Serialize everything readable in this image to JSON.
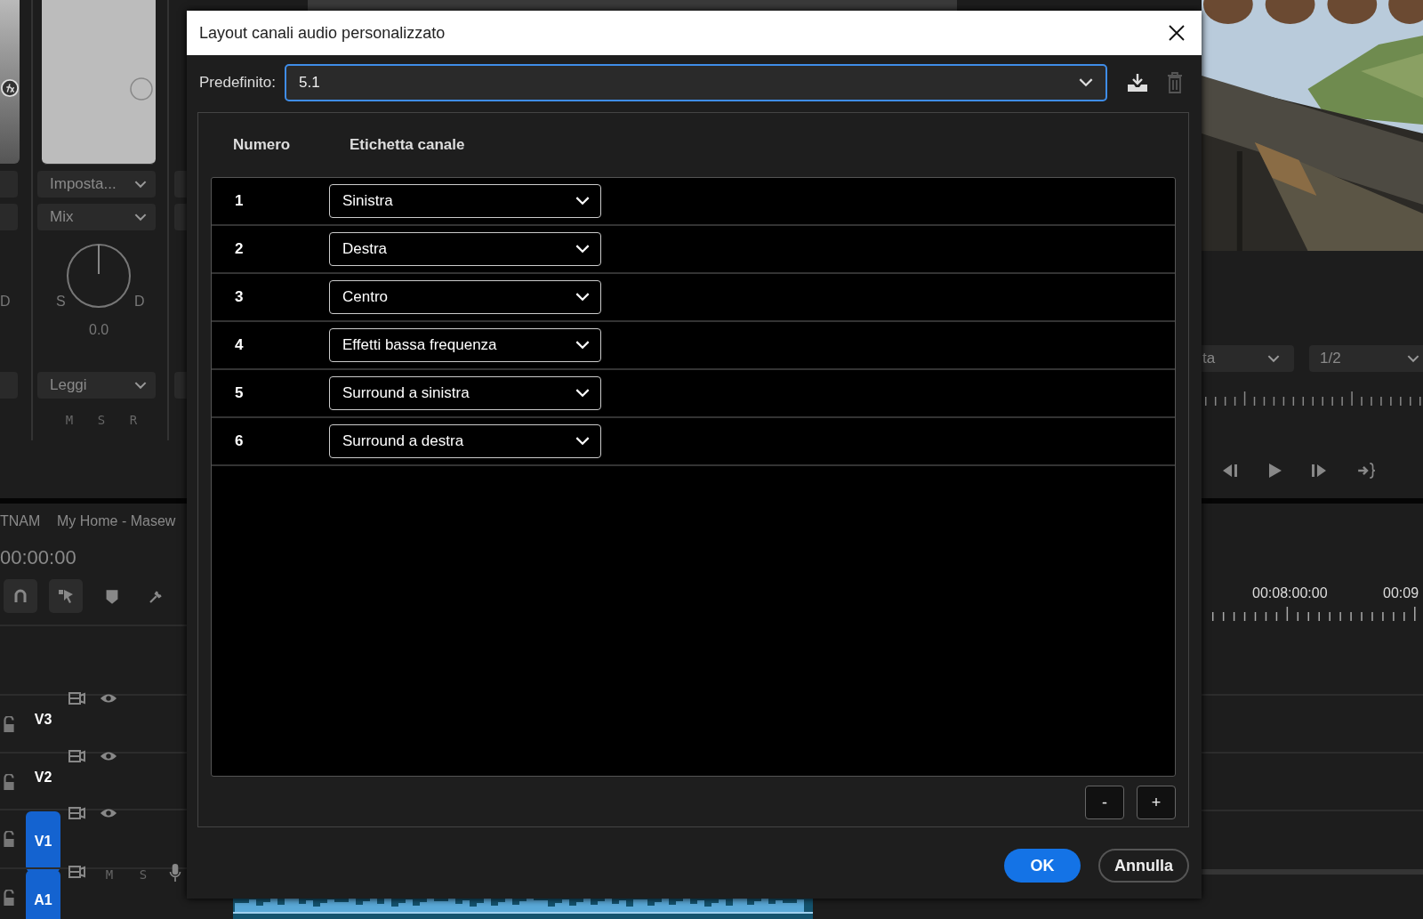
{
  "background": {
    "mixer": {
      "neighbor_pan_right": "D",
      "preset": "Imposta...",
      "mode": "Mix",
      "pan_left": "S",
      "pan_right": "D",
      "pan_value": "0.0",
      "automation": "Leggi",
      "buttons": [
        "M",
        "S",
        "R"
      ]
    },
    "timeline": {
      "tab_fragment": "TNAM",
      "tab": "My Home - Masew",
      "timecode": "00:00:00",
      "tracks": [
        {
          "label": "V3",
          "kind": "video",
          "selected": false
        },
        {
          "label": "V2",
          "kind": "video",
          "selected": false
        },
        {
          "label": "V1",
          "kind": "video",
          "selected": true
        },
        {
          "label": "A1",
          "kind": "audio",
          "selected": true,
          "buttons": [
            "M",
            "S"
          ]
        }
      ],
      "ruler_labels": [
        "00:08:00:00",
        "00:09"
      ]
    },
    "program_monitor": {
      "fit_dropdown": "ta",
      "resolution_dropdown": "1/2"
    }
  },
  "dialog": {
    "title": "Layout canali audio personalizzato",
    "preset_label": "Predefinito:",
    "preset_value": "5.1",
    "delete_disabled": true,
    "columns": [
      "Numero",
      "Etichetta canale"
    ],
    "channels": [
      {
        "number": "1",
        "label": "Sinistra"
      },
      {
        "number": "2",
        "label": "Destra"
      },
      {
        "number": "3",
        "label": "Centro"
      },
      {
        "number": "4",
        "label": "Effetti bassa frequenza"
      },
      {
        "number": "5",
        "label": "Surround a sinistra"
      },
      {
        "number": "6",
        "label": "Surround a destra"
      }
    ],
    "remove_button": "-",
    "add_button": "+",
    "ok_button": "OK",
    "cancel_button": "Annulla"
  }
}
